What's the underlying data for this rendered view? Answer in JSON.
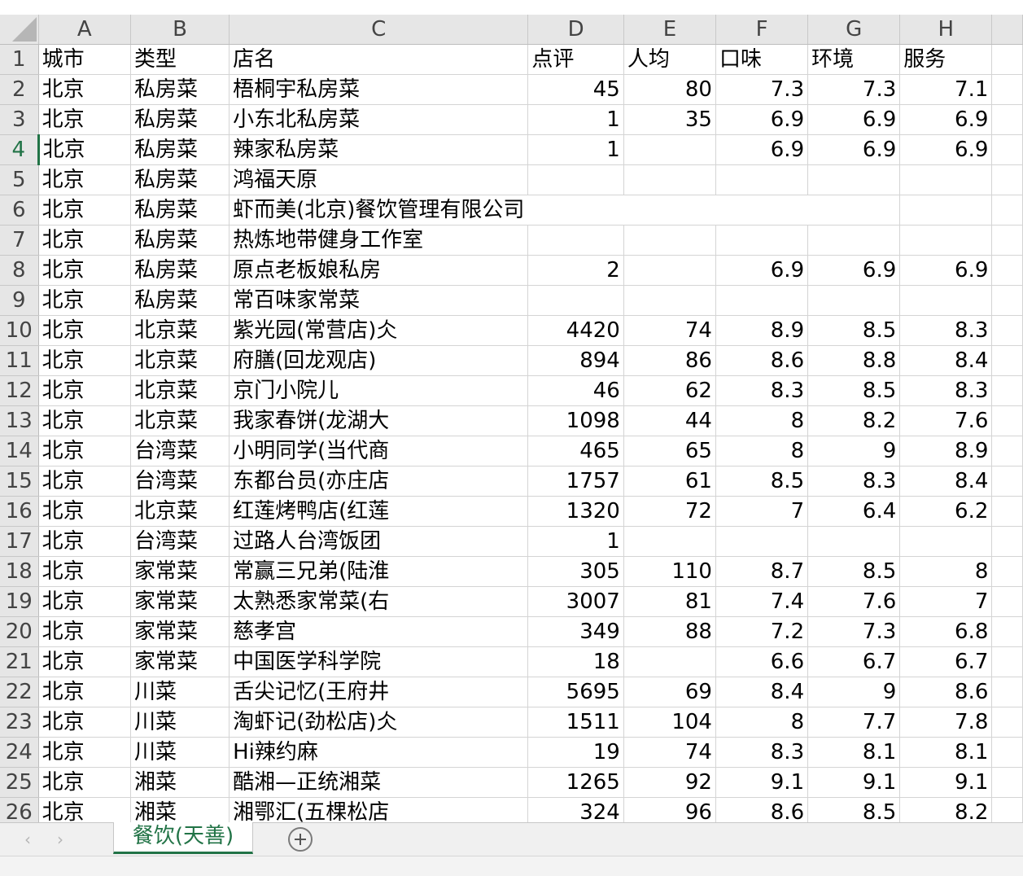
{
  "sheet": {
    "columns": [
      "A",
      "B",
      "C",
      "D",
      "E",
      "F",
      "G",
      "H"
    ],
    "active_row": "4",
    "rows": [
      {
        "n": "1",
        "cells": [
          "城市",
          "类型",
          "店名",
          "点评",
          "人均",
          "口味",
          "环境",
          "服务"
        ]
      },
      {
        "n": "2",
        "cells": [
          "北京",
          "私房菜",
          "梧桐宇私房菜",
          "45",
          "80",
          "7.3",
          "7.3",
          "7.1"
        ]
      },
      {
        "n": "3",
        "cells": [
          "北京",
          "私房菜",
          "小东北私房菜",
          "1",
          "35",
          "6.9",
          "6.9",
          "6.9"
        ]
      },
      {
        "n": "4",
        "cells": [
          "北京",
          "私房菜",
          "辣家私房菜",
          "1",
          "",
          "6.9",
          "6.9",
          "6.9"
        ]
      },
      {
        "n": "5",
        "cells": [
          "北京",
          "私房菜",
          "鸿福天原",
          "",
          "",
          "",
          "",
          ""
        ]
      },
      {
        "n": "6",
        "cells": [
          "北京",
          "私房菜",
          "虾而美(北京)餐饮管理有限公司",
          "",
          "",
          "",
          "",
          ""
        ]
      },
      {
        "n": "7",
        "cells": [
          "北京",
          "私房菜",
          "热炼地带健身工作室",
          "",
          "",
          "",
          "",
          ""
        ]
      },
      {
        "n": "8",
        "cells": [
          "北京",
          "私房菜",
          "原点老板娘私房",
          "2",
          "",
          "6.9",
          "6.9",
          "6.9"
        ]
      },
      {
        "n": "9",
        "cells": [
          "北京",
          "私房菜",
          "常百味家常菜",
          "",
          "",
          "",
          "",
          ""
        ]
      },
      {
        "n": "10",
        "cells": [
          "北京",
          "北京菜",
          "紫光园(常营店)仌",
          "4420",
          "74",
          "8.9",
          "8.5",
          "8.3"
        ]
      },
      {
        "n": "11",
        "cells": [
          "北京",
          "北京菜",
          "府膳(回龙观店)",
          "894",
          "86",
          "8.6",
          "8.8",
          "8.4"
        ]
      },
      {
        "n": "12",
        "cells": [
          "北京",
          "北京菜",
          "京门小院儿",
          "46",
          "62",
          "8.3",
          "8.5",
          "8.3"
        ]
      },
      {
        "n": "13",
        "cells": [
          "北京",
          "北京菜",
          "我家春饼(龙湖大",
          "1098",
          "44",
          "8",
          "8.2",
          "7.6"
        ]
      },
      {
        "n": "14",
        "cells": [
          "北京",
          "台湾菜",
          "小明同学(当代商",
          "465",
          "65",
          "8",
          "9",
          "8.9"
        ]
      },
      {
        "n": "15",
        "cells": [
          "北京",
          "台湾菜",
          "东都台员(亦庄店",
          "1757",
          "61",
          "8.5",
          "8.3",
          "8.4"
        ]
      },
      {
        "n": "16",
        "cells": [
          "北京",
          "北京菜",
          "红莲烤鸭店(红莲",
          "1320",
          "72",
          "7",
          "6.4",
          "6.2"
        ]
      },
      {
        "n": "17",
        "cells": [
          "北京",
          "台湾菜",
          "过路人台湾饭团",
          "1",
          "",
          "",
          "",
          ""
        ]
      },
      {
        "n": "18",
        "cells": [
          "北京",
          "家常菜",
          "常赢三兄弟(陆淮",
          "305",
          "110",
          "8.7",
          "8.5",
          "8"
        ]
      },
      {
        "n": "19",
        "cells": [
          "北京",
          "家常菜",
          "太熟悉家常菜(右",
          "3007",
          "81",
          "7.4",
          "7.6",
          "7"
        ]
      },
      {
        "n": "20",
        "cells": [
          "北京",
          "家常菜",
          "慈孝宫",
          "349",
          "88",
          "7.2",
          "7.3",
          "6.8"
        ]
      },
      {
        "n": "21",
        "cells": [
          "北京",
          "家常菜",
          "中国医学科学院",
          "18",
          "",
          "6.6",
          "6.7",
          "6.7"
        ]
      },
      {
        "n": "22",
        "cells": [
          "北京",
          "川菜",
          "舌尖记忆(王府井",
          "5695",
          "69",
          "8.4",
          "9",
          "8.6"
        ]
      },
      {
        "n": "23",
        "cells": [
          "北京",
          "川菜",
          "淘虾记(劲松店)仌",
          "1511",
          "104",
          "8",
          "7.7",
          "7.8"
        ]
      },
      {
        "n": "24",
        "cells": [
          "北京",
          "川菜",
          "Hi辣约麻",
          "19",
          "74",
          "8.3",
          "8.1",
          "8.1"
        ]
      },
      {
        "n": "25",
        "cells": [
          "北京",
          "湘菜",
          "酷湘—正统湘菜",
          "1265",
          "92",
          "9.1",
          "9.1",
          "9.1"
        ]
      },
      {
        "n": "26",
        "cells": [
          "北京",
          "湘菜",
          "湘鄂汇(五棵松店",
          "324",
          "96",
          "8.6",
          "8.5",
          "8.2"
        ]
      }
    ]
  },
  "tabs": {
    "active_label": "餐饮(天善)",
    "prev_glyph": "‹",
    "next_glyph": "›"
  },
  "colors": {
    "accent": "#217346",
    "header_bg": "#e6e6e6",
    "gridline": "#d4d4d4"
  }
}
